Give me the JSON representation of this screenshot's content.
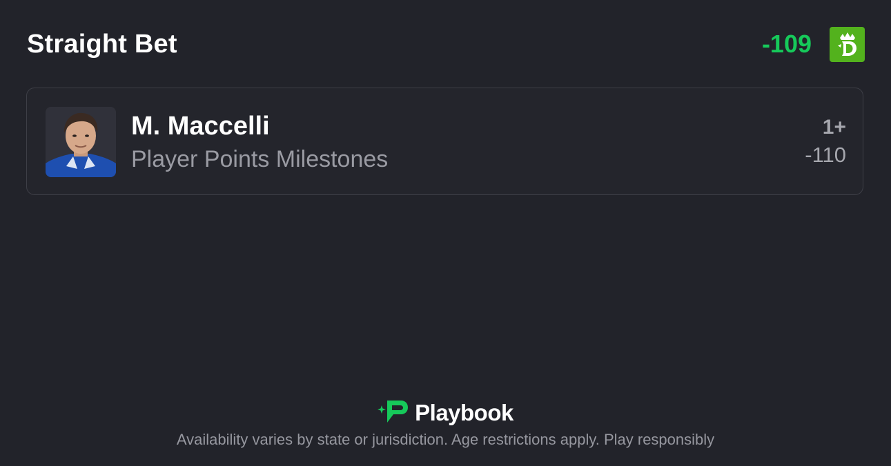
{
  "header": {
    "title": "Straight Bet",
    "total_odds": "-109",
    "odds_color": "#16c95a",
    "sportsbook_logo_icon": "draftkings-logo-icon",
    "sportsbook_logo_color": "#53b21d"
  },
  "leg": {
    "player_name": "M. Maccelli",
    "market": "Player Points Milestones",
    "line": "1+",
    "odds": "-110",
    "avatar_icon": "player-headshot"
  },
  "footer": {
    "brand_name": "Playbook",
    "brand_icon": "playbook-logo-icon",
    "brand_color": "#16c95a",
    "disclaimer": "Availability varies by state or jurisdiction. Age restrictions apply. Play responsibly"
  }
}
